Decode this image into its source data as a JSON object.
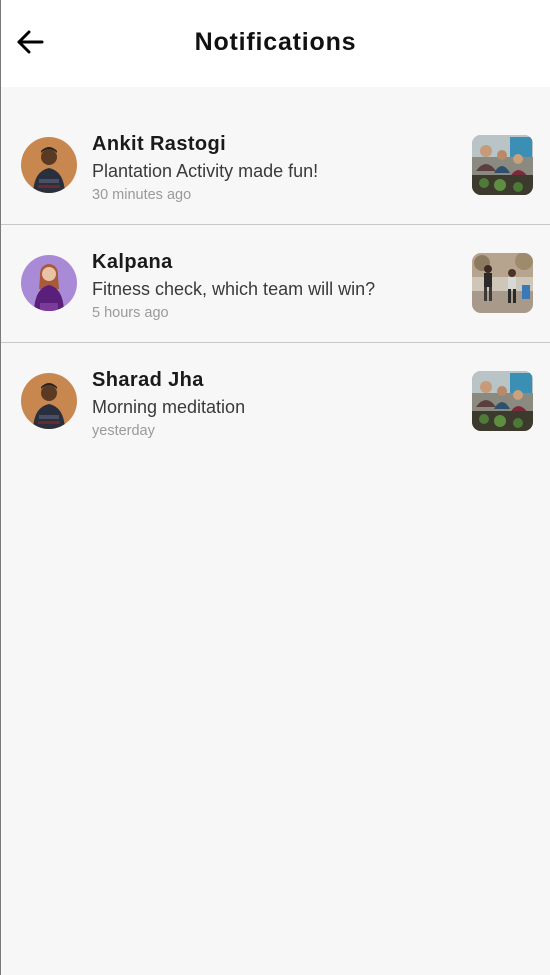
{
  "header": {
    "title": "Notifications",
    "back_icon": "arrow-left-icon"
  },
  "notifications": [
    {
      "name": "Ankit Rastogi",
      "message": "Plantation Activity made fun!",
      "time": "30 minutes ago",
      "avatar": "man-avatar",
      "thumbnail": "plantation-photo"
    },
    {
      "name": "Kalpana",
      "message": "Fitness check, which team will win?",
      "time": "5 hours ago",
      "avatar": "woman-avatar",
      "thumbnail": "fitness-photo"
    },
    {
      "name": "Sharad Jha",
      "message": "Morning meditation",
      "time": "yesterday",
      "avatar": "man-avatar",
      "thumbnail": "plantation-photo"
    }
  ],
  "colors": {
    "header_bg": "#ffffff",
    "page_bg": "#f7f7f7",
    "divider": "#c8c8c8",
    "name_text": "#1a1a1a",
    "time_text": "#9a9a9a"
  }
}
